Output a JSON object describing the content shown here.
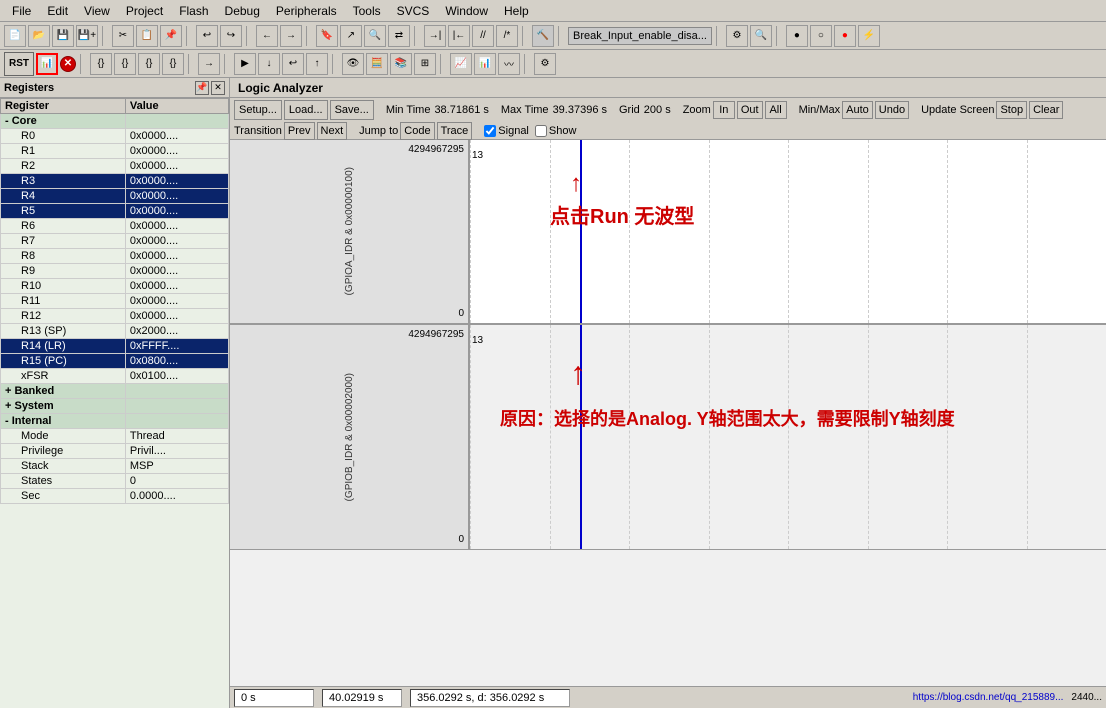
{
  "menuBar": {
    "items": [
      "File",
      "Edit",
      "View",
      "Project",
      "Flash",
      "Debug",
      "Peripherals",
      "Tools",
      "SVCS",
      "Window",
      "Help"
    ]
  },
  "toolbar1": {
    "buttons": [
      "new",
      "open",
      "save",
      "saveas",
      "undo",
      "redo",
      "prev",
      "next",
      "find",
      "replace",
      "build",
      "rebuild",
      "stop"
    ]
  },
  "toolbar2": {
    "rstLabel": "RST",
    "buttons": [
      "{}",
      "{}",
      "{}",
      "{}",
      "->",
      "run",
      "step",
      "step-in",
      "step-out",
      "run-to"
    ]
  },
  "logicAnalyzer": {
    "title": "Logic Analyzer",
    "setupLabel": "Setup...",
    "loadLabel": "Load...",
    "saveLabel": "Save...",
    "minTimeLabel": "Min Time",
    "minTimeValue": "38.71861 s",
    "maxTimeLabel": "Max Time",
    "maxTimeValue": "39.37396 s",
    "gridLabel": "Grid",
    "gridValue": "200 s",
    "zoomLabel": "Zoom",
    "zoomIn": "In",
    "zoomOut": "Out",
    "zoomAll": "All",
    "minMaxLabel": "Min/Max",
    "autoLabel": "Auto",
    "undoLabel": "Undo",
    "updateScreenLabel": "Update Screen",
    "stopLabel": "Stop",
    "clearLabel": "Clear",
    "transitionLabel": "Transition",
    "prevLabel": "Prev",
    "nextLabel": "Next",
    "jumpToLabel": "Jump to",
    "codeLabel": "Code",
    "traceLabel": "Trace",
    "signalLabel": "Signal",
    "showLabel": "Show",
    "channel1": {
      "name": "(GPIOA_IDR & 0x00000100)",
      "topValue": "4294967295",
      "bottomValue": "0",
      "yLabel": "13"
    },
    "channel2": {
      "name": "(GPIOB_IDR & 0x00002000)",
      "topValue": "4294967295",
      "bottomValue": "0",
      "yLabel": "13"
    },
    "annotation1": "点击Run 无波型",
    "annotation2": "原因：选择的是Analog. Y轴范围太大，需要限制Y轴刻度",
    "statusTime1": "0 s",
    "statusTime2": "40.02919 s",
    "statusCursor": "356.0292 s,  d: 356.0292 s",
    "statusUrl": "https://blog.csdn.net/qq_215889...",
    "statusNum": "2440..."
  },
  "registers": {
    "title": "Registers",
    "columns": [
      "Register",
      "Value"
    ],
    "rows": [
      {
        "name": "Core",
        "value": "",
        "type": "group",
        "indent": 0
      },
      {
        "name": "R0",
        "value": "0x0000....",
        "type": "normal",
        "indent": 1
      },
      {
        "name": "R1",
        "value": "0x0000....",
        "type": "normal",
        "indent": 1
      },
      {
        "name": "R2",
        "value": "0x0000....",
        "type": "normal",
        "indent": 1
      },
      {
        "name": "R3",
        "value": "0x0000....",
        "type": "selected",
        "indent": 1
      },
      {
        "name": "R4",
        "value": "0x0000....",
        "type": "selected",
        "indent": 1
      },
      {
        "name": "R5",
        "value": "0x0000....",
        "type": "selected",
        "indent": 1
      },
      {
        "name": "R6",
        "value": "0x0000....",
        "type": "normal",
        "indent": 1
      },
      {
        "name": "R7",
        "value": "0x0000....",
        "type": "normal",
        "indent": 1
      },
      {
        "name": "R8",
        "value": "0x0000....",
        "type": "normal",
        "indent": 1
      },
      {
        "name": "R9",
        "value": "0x0000....",
        "type": "normal",
        "indent": 1
      },
      {
        "name": "R10",
        "value": "0x0000....",
        "type": "normal",
        "indent": 1
      },
      {
        "name": "R11",
        "value": "0x0000....",
        "type": "normal",
        "indent": 1
      },
      {
        "name": "R12",
        "value": "0x0000....",
        "type": "normal",
        "indent": 1
      },
      {
        "name": "R13 (SP)",
        "value": "0x2000....",
        "type": "normal",
        "indent": 1
      },
      {
        "name": "R14 (LR)",
        "value": "0xFFFF....",
        "type": "selected",
        "indent": 1
      },
      {
        "name": "R15 (PC)",
        "value": "0x0800....",
        "type": "selected",
        "indent": 1
      },
      {
        "name": "xFSR",
        "value": "0x0100....",
        "type": "normal",
        "indent": 1
      },
      {
        "name": "Banked",
        "value": "",
        "type": "group-expand",
        "indent": 0
      },
      {
        "name": "System",
        "value": "",
        "type": "group-expand",
        "indent": 0
      },
      {
        "name": "Internal",
        "value": "",
        "type": "group-open",
        "indent": 0
      },
      {
        "name": "Mode",
        "value": "Thread",
        "type": "normal",
        "indent": 1
      },
      {
        "name": "Privilege",
        "value": "Privil....",
        "type": "normal",
        "indent": 1
      },
      {
        "name": "Stack",
        "value": "MSP",
        "type": "normal",
        "indent": 1
      },
      {
        "name": "States",
        "value": "0",
        "type": "normal",
        "indent": 1
      },
      {
        "name": "Sec",
        "value": "0.0000....",
        "type": "normal",
        "indent": 1
      }
    ]
  },
  "icons": {
    "new": "📄",
    "save": "💾",
    "undo": "↩",
    "redo": "↪",
    "build": "🔨",
    "debug": "🐛",
    "pin": "📌",
    "close": "✕",
    "expand": "+",
    "collapse": "-"
  }
}
